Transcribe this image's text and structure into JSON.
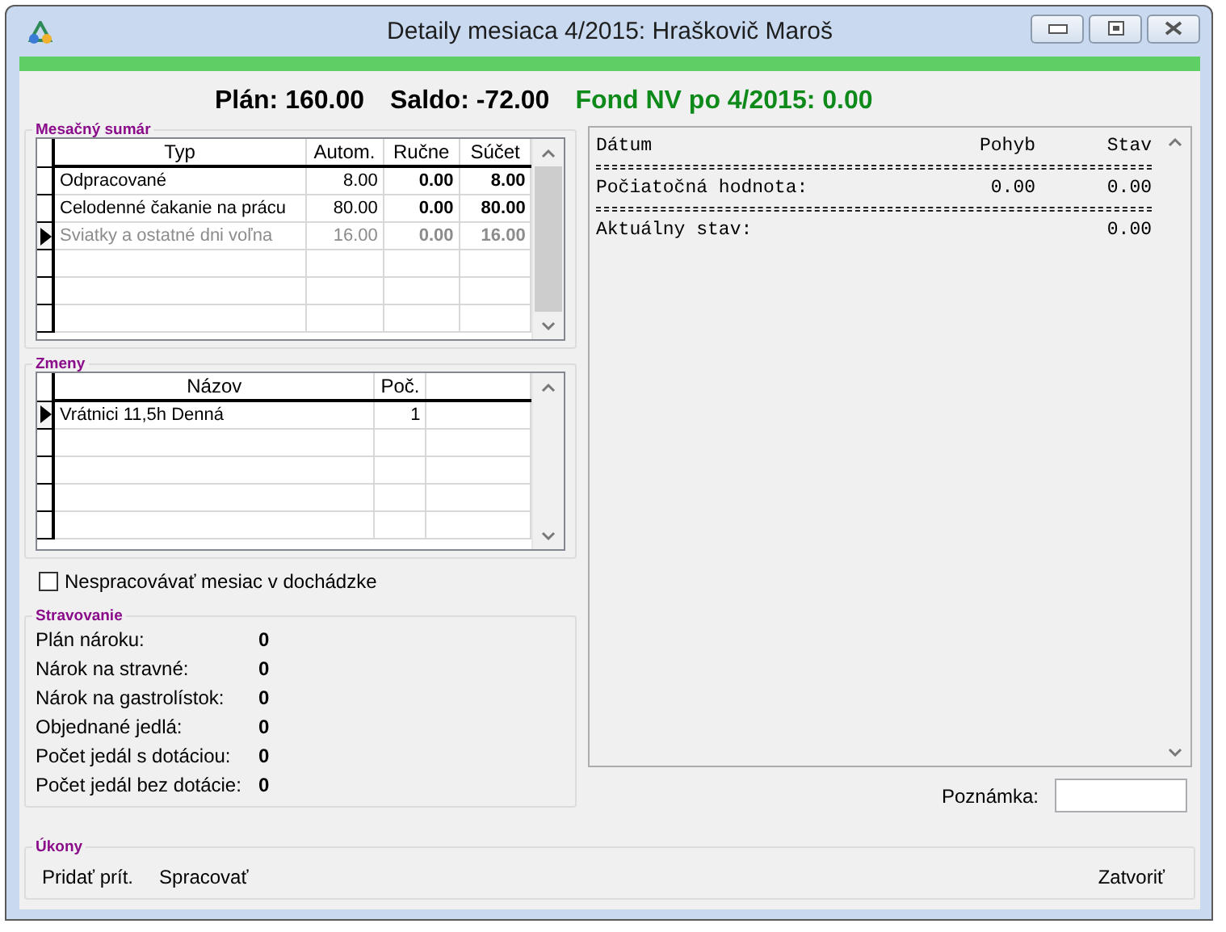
{
  "window": {
    "title": "Detaily mesiaca 4/2015: Hraškovič Maroš"
  },
  "progress": {
    "level": 1
  },
  "summary": [
    {
      "kind": "plain",
      "text": "Plán: 160.00"
    },
    {
      "kind": "plain",
      "text": "Saldo: -72.00"
    },
    {
      "kind": "highlight",
      "text": "Fond NV po 4/2015: 0.00"
    }
  ],
  "monthly_summary": {
    "title": "Mesačný sumár",
    "columns": [
      "Typ",
      "Autom.",
      "Ručne",
      "Súčet"
    ],
    "rows": [
      {
        "cells": [
          "Odpracované",
          "8.00",
          "0.00",
          "8.00"
        ],
        "selected": false,
        "disabled": false
      },
      {
        "cells": [
          "Celodenné čakanie na prácu",
          "80.00",
          "0.00",
          "80.00"
        ],
        "selected": false,
        "disabled": false
      },
      {
        "cells": [
          "Sviatky a ostatné dni voľna",
          "16.00",
          "0.00",
          "16.00"
        ],
        "selected": true,
        "disabled": true
      }
    ]
  },
  "shifts": {
    "title": "Zmeny",
    "columns": [
      "Názov",
      "Poč."
    ],
    "rows": [
      {
        "cells": [
          "Vrátnici 11,5h Denná",
          "1"
        ],
        "selected": true
      }
    ]
  },
  "checkbox": {
    "label": "Nespracovávať mesiac v dochádzke",
    "checked": false
  },
  "meals": {
    "title": "Stravovanie",
    "items": [
      {
        "label": "Plán nároku:",
        "value": "0"
      },
      {
        "label": "Nárok na stravné:",
        "value": "0"
      },
      {
        "label": "Nárok na gastrolístok:",
        "value": "0"
      },
      {
        "label": "Objednané jedlá:",
        "value": "0"
      },
      {
        "label": "Počet jedál s dotáciou:",
        "value": "0"
      },
      {
        "label": "Počet jedál bez dotácie:",
        "value": "0"
      }
    ]
  },
  "log": {
    "columns": [
      "Dátum",
      "Pohyb",
      "Stav"
    ],
    "lines": [
      {
        "kind": "separator"
      },
      {
        "kind": "entry",
        "label": "Počiatočná hodnota:",
        "movement": "0.00",
        "state": "0.00"
      },
      {
        "kind": "separator"
      },
      {
        "kind": "entry",
        "label": "Aktuálny stav:",
        "state": "0.00"
      }
    ]
  },
  "note": {
    "label": "Poznámka:"
  },
  "actions": {
    "title": "Úkony",
    "left_buttons": [
      "Pridať prít.",
      "Spracovať"
    ],
    "right_buttons": [
      "Zatvoriť"
    ]
  }
}
